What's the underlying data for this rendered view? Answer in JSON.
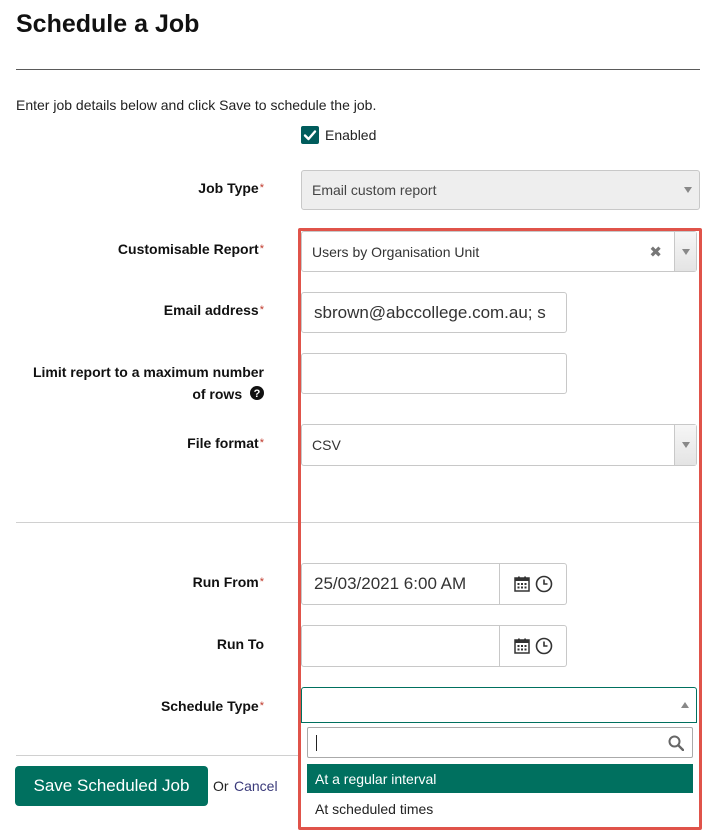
{
  "page": {
    "title": "Schedule a Job",
    "intro": "Enter job details below and click Save to schedule the job."
  },
  "form": {
    "enabled_label": "Enabled",
    "required_mark": "*",
    "job_type": {
      "label": "Job Type",
      "value": "Email custom report"
    },
    "report": {
      "label": "Customisable Report",
      "value": "Users by Organisation Unit"
    },
    "email": {
      "label": "Email address",
      "value": "sbrown@abccollege.com.au; s"
    },
    "limit_rows": {
      "label_line1": "Limit report to a maximum number",
      "label_line2": "of rows",
      "value": ""
    },
    "file_format": {
      "label": "File format",
      "value": "CSV"
    },
    "run_from": {
      "label": "Run From",
      "value": "25/03/2021 6:00 AM"
    },
    "run_to": {
      "label": "Run To",
      "value": ""
    },
    "schedule_type": {
      "label": "Schedule Type",
      "value": "",
      "search_value": "",
      "options": [
        "At a regular interval",
        "At scheduled times"
      ],
      "highlighted_option": "At a regular interval"
    }
  },
  "actions": {
    "save_label": "Save Scheduled Job",
    "or_text": "Or",
    "cancel_label": "Cancel"
  },
  "icons": {
    "check": "check-icon",
    "help": "question-circle-icon",
    "calendar": "calendar-icon",
    "clock": "clock-icon",
    "search": "search-icon",
    "clear": "clear-x-icon"
  },
  "colors": {
    "accent": "#00705f",
    "checkbox": "#005c5c",
    "required": "#c0392b",
    "highlight_border": "#e0534a"
  }
}
